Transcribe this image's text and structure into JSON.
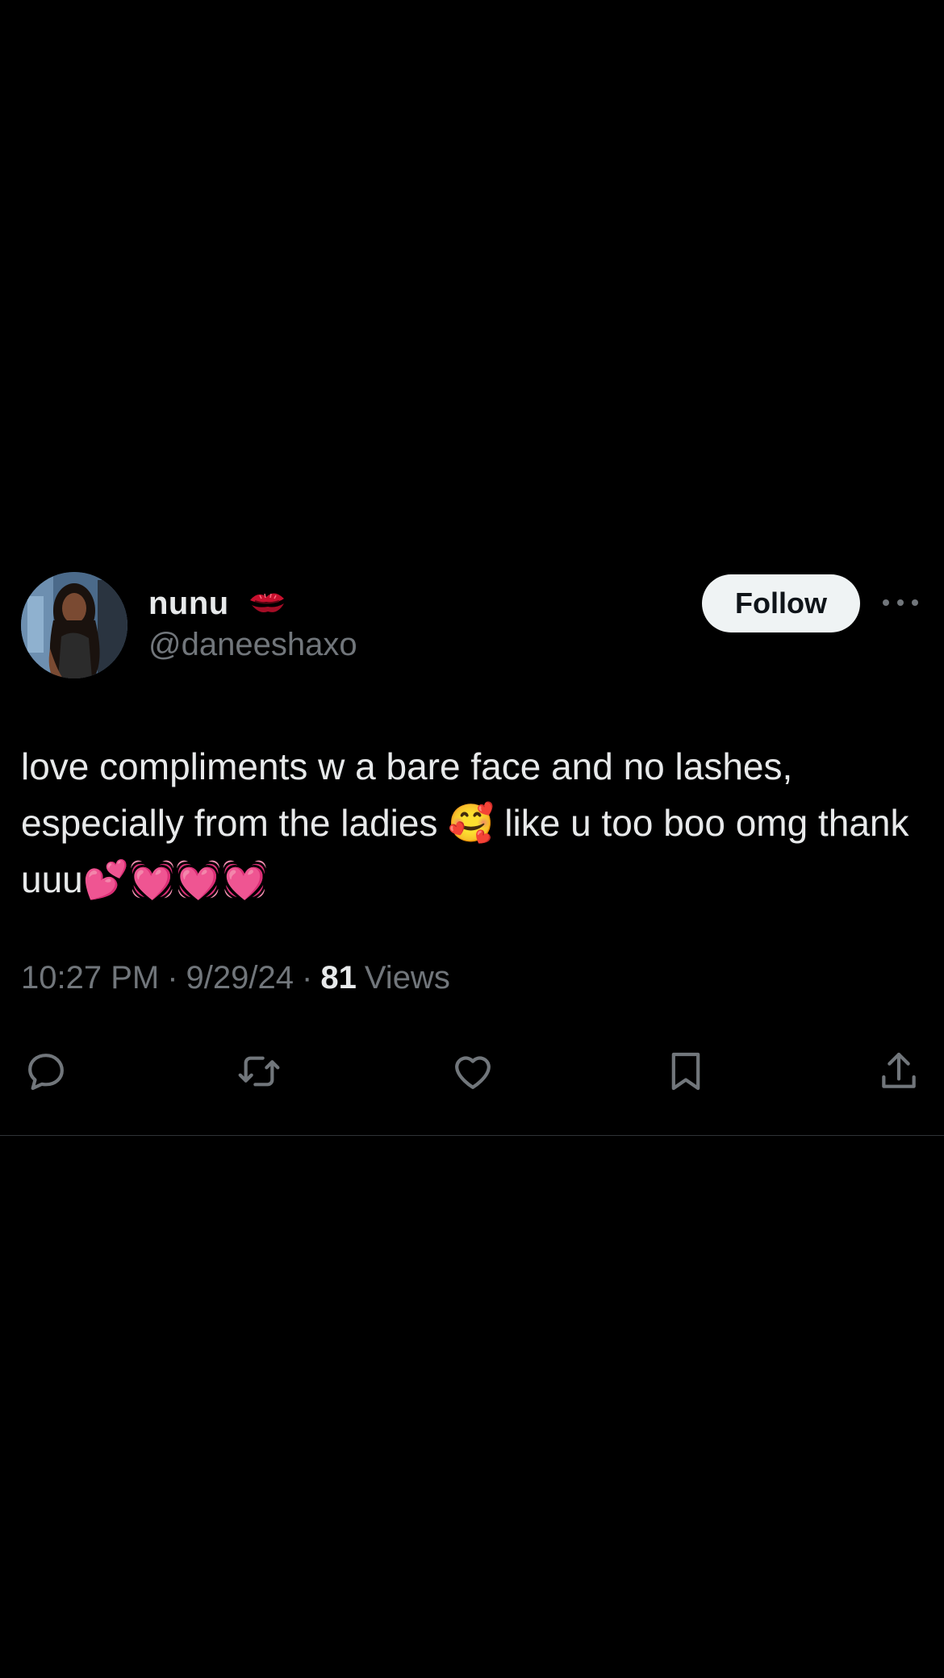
{
  "tweet": {
    "display_name": "nunu",
    "name_emoji_icon": "kiss-mark-icon",
    "handle": "@daneeshaxo",
    "follow_label": "Follow",
    "text": "love compliments w a bare face and no lashes, especially from the ladies 🥰 like u too boo omg thank uuu💕💓💓💓",
    "time": "10:27 PM",
    "separator": "·",
    "date": "9/29/24",
    "views_count": "81",
    "views_label": "Views"
  },
  "actions": [
    {
      "icon": "reply-icon"
    },
    {
      "icon": "retweet-icon"
    },
    {
      "icon": "like-icon"
    },
    {
      "icon": "bookmark-icon"
    },
    {
      "icon": "share-icon"
    }
  ],
  "colors": {
    "background": "#000000",
    "primary_text": "#e7e9ea",
    "secondary_text": "#71767b",
    "follow_button_bg": "#eff3f4",
    "divider": "#2f3336"
  }
}
